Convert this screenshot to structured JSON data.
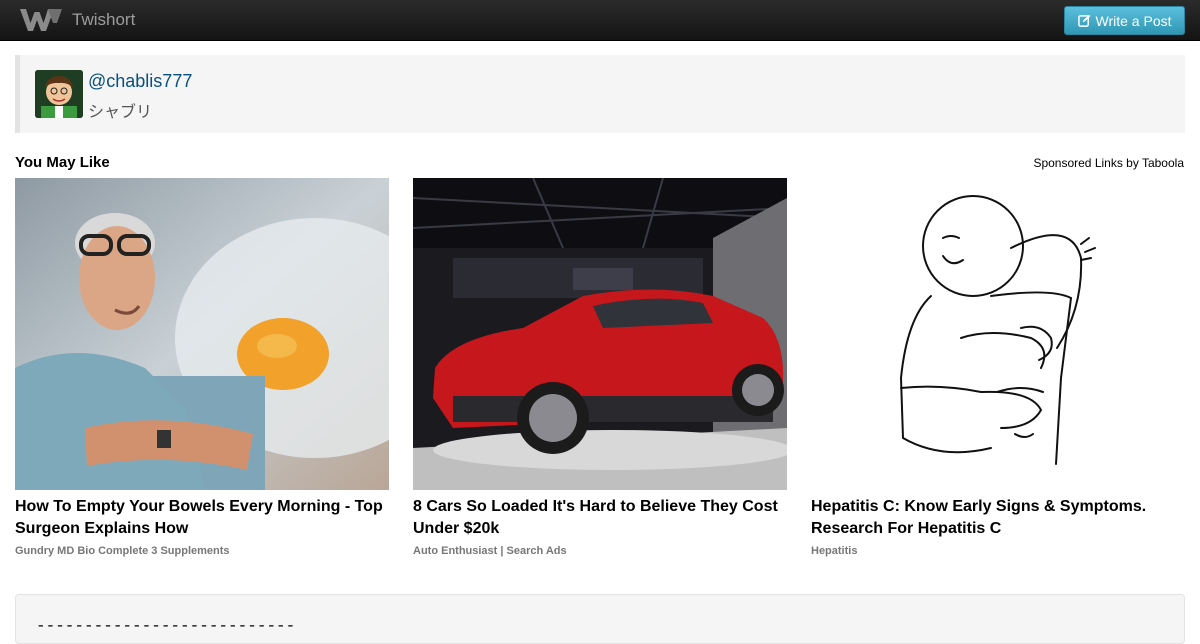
{
  "navbar": {
    "brand": "Twishort",
    "write_label": "Write a Post",
    "colors": {
      "bar": "#1b1b1b",
      "button": "#49afcd"
    }
  },
  "user": {
    "handle": "@chablis777",
    "display_name": "シャブリ"
  },
  "recommendations": {
    "heading": "You May Like",
    "sponsored_label": "Sponsored Links by Taboola",
    "items": [
      {
        "title": "How To Empty Your Bowels Every Morning - Top Surgeon Explains How",
        "source": "Gundry MD Bio Complete 3 Supplements",
        "image": "surgeon-with-egg"
      },
      {
        "title": "8 Cars So Loaded It's Hard to Believe They Cost Under $20k",
        "source": "Auto Enthusiast | Search Ads",
        "image": "red-suv-at-autoshow"
      },
      {
        "title": "Hepatitis C: Know Early Signs & Symptoms. Research For Hepatitis C",
        "source": "Hepatitis",
        "image": "man-scratching-back-drawing"
      }
    ]
  },
  "post": {
    "divider_text": "---------------------------"
  }
}
